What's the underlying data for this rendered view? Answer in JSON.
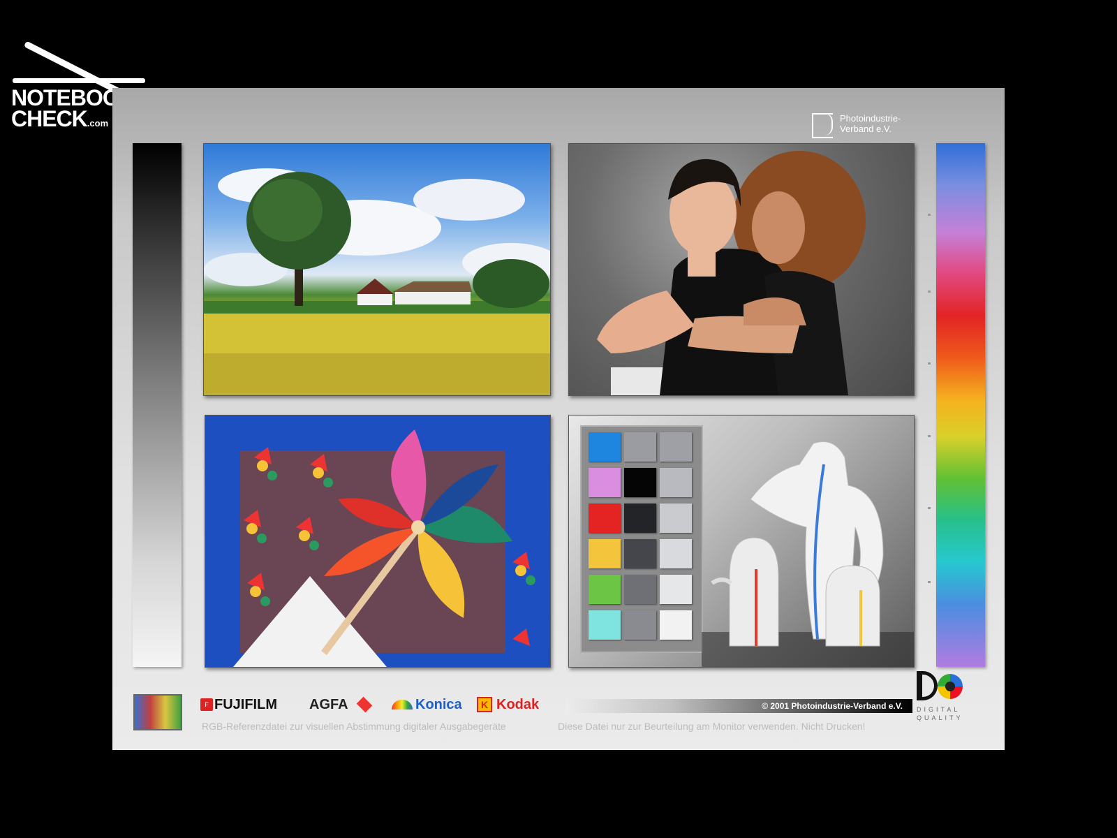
{
  "watermark": {
    "line1": "NOTEBOOK",
    "line2": "CHECK",
    "line2_suffix": ".com"
  },
  "publisher": {
    "line1": "Photoindustrie-",
    "line2": "Verband e.V."
  },
  "brands": [
    "FUJIFILM",
    "AGFA",
    "Konica",
    "Kodak"
  ],
  "footer": {
    "copyright": "© 2001 Photoindustrie-Verband e.V.",
    "caption_left": "RGB-Referenzdatei zur visuellen Abstimmung digitaler Ausgabegeräte",
    "caption_right": "Diese Datei  nur zur Beurteilung am Monitor verwenden. Nicht Drucken!"
  },
  "dq_logo": {
    "line1": "DIGITAL",
    "line2": "QUALITY"
  },
  "color_chart": {
    "swatches": [
      [
        "#1f86e0",
        "#9a9ca2",
        "#9fa0a5"
      ],
      [
        "#d98ee0",
        "#050505",
        "#b8babf"
      ],
      [
        "#e42323",
        "#232428",
        "#c9cbcf"
      ],
      [
        "#f3c53d",
        "#44464b",
        "#d9dadd"
      ],
      [
        "#6cc544",
        "#6e7075",
        "#e6e7e9"
      ],
      [
        "#7fe3e0",
        "#898b90",
        "#f2f2f3"
      ]
    ]
  }
}
